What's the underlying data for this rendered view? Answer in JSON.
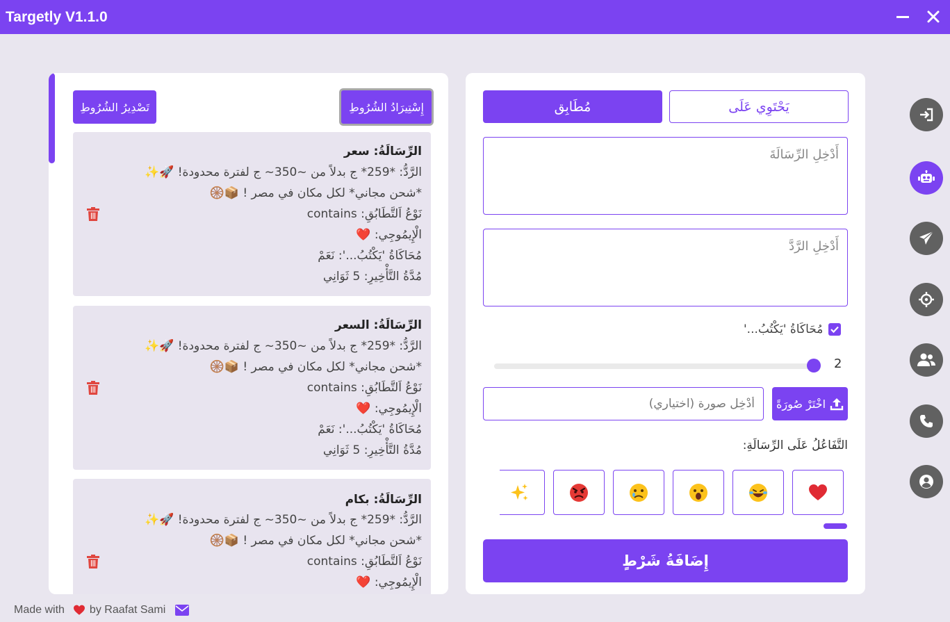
{
  "app": {
    "title": "Targetly V1.1.0"
  },
  "window": {
    "minimize_icon": "minimize-icon",
    "close_icon": "close-icon"
  },
  "sidebar": {
    "items": [
      {
        "icon": "login-icon",
        "active": false
      },
      {
        "icon": "robot-icon",
        "active": true
      },
      {
        "icon": "send-icon",
        "active": false
      },
      {
        "icon": "crosshair-icon",
        "active": false
      },
      {
        "icon": "users-icon",
        "active": false
      },
      {
        "icon": "phone-icon",
        "active": false
      },
      {
        "icon": "account-icon",
        "active": false
      }
    ]
  },
  "rules_panel": {
    "import_label": "إِسْتِيرَادُ الشُرُوطِ",
    "export_label": "تَصْدِيرُ الشُرُوطِ",
    "cards": [
      {
        "message": "الرِّسَالَةُ: سعر",
        "reply1": "الرَّدُّ: *259* ج بدلاً من ~350~ ج لفترة محدودة! 🚀✨",
        "reply2": "*شحن مجاني* لكل مكان في مصر ! 📦🛞",
        "match_type": "نَوْعُ اَلتَّطَابُقِ: contains",
        "emoji": "الْإِيمُوجِي: ❤️",
        "typing": "مُحَاكَاةُ 'يَكْتُبُ...': نَعَمْ",
        "delay": "مُدَّةُ التَّأْخِيرِ: 5 ثَوَانِي"
      },
      {
        "message": "الرِّسَالَةُ: السعر",
        "reply1": "الرَّدُّ: *259* ج بدلاً من ~350~ ج لفترة محدودة! 🚀✨",
        "reply2": "*شحن مجاني* لكل مكان في مصر ! 📦🛞",
        "match_type": "نَوْعُ اَلتَّطَابُقِ: contains",
        "emoji": "الْإِيمُوجِي: ❤️",
        "typing": "مُحَاكَاةُ 'يَكْتُبُ...': نَعَمْ",
        "delay": "مُدَّةُ التَّأْخِيرِ: 5 ثَوَانِي"
      },
      {
        "message": "الرِّسَالَةُ: بكام",
        "reply1": "الرَّدُّ: *259* ج بدلاً من ~350~ ج لفترة محدودة! 🚀✨",
        "reply2": "*شحن مجاني* لكل مكان في مصر ! 📦🛞",
        "match_type": "نَوْعُ اَلتَّطَابُقِ: contains",
        "emoji": "الْإِيمُوجِي: ❤️"
      }
    ]
  },
  "form": {
    "tab_matching": "مُطَابِق",
    "tab_contains": "يَحْتَوِي عَلَى",
    "message_placeholder": "أَدْخِلِ الرِّسَالَةَ",
    "reply_placeholder": "أَدْخِلِ الرَّدَّ",
    "typing_label": "مُحَاكَاةُ 'يَكْتُبُ...'",
    "typing_checked": true,
    "delay_value": "2",
    "delay_fraction": 1.0,
    "image_placeholder": "أَدْخِل صورة (اختياري)",
    "choose_image_label": "اخْتَرْ صُورَةً",
    "reactions_label": "التَّفَاعُلُ عَلَى الرِّسَالَةِ:",
    "reactions": [
      "❤️",
      "😂",
      "😮",
      "😢",
      "😡",
      "✨"
    ],
    "add_rule_label": "إِضَافَةُ شَرْطٍ"
  },
  "footer": {
    "made_with": "Made with",
    "heart": "❤️",
    "by": "by Raafat Sami",
    "mail_icon": "mail-icon"
  },
  "colors": {
    "accent": "#7b43f1",
    "background": "#e9e6ef",
    "card": "#e8e4ef",
    "danger": "#e0463f",
    "sidebar_button": "#616161"
  }
}
